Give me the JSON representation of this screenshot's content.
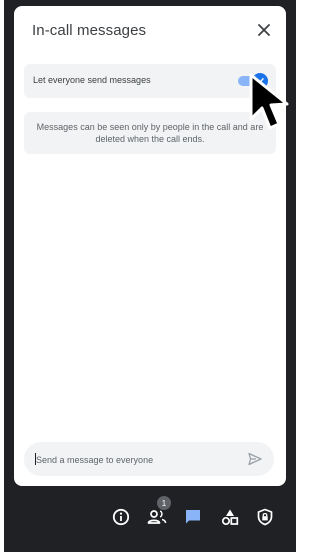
{
  "panel": {
    "title": "In-call messages",
    "close_icon": "close-icon"
  },
  "settings": {
    "toggle_label": "Let everyone send messages",
    "toggle_on": true,
    "accent": "#1a73e8"
  },
  "notice": {
    "text": "Messages can be seen only by people in the call and are deleted when the call ends."
  },
  "composer": {
    "placeholder": "Send a message to everyone",
    "send_icon": "send-icon"
  },
  "toolbar": {
    "items": [
      {
        "icon": "info-icon"
      },
      {
        "icon": "people-icon",
        "badge": "1"
      },
      {
        "icon": "chat-icon",
        "active": true
      },
      {
        "icon": "activities-icon"
      },
      {
        "icon": "host-controls-icon"
      }
    ]
  },
  "colors": {
    "background": "#202124",
    "panel": "#ffffff",
    "surface": "#f1f3f4",
    "text": "#3c4043",
    "muted": "#5f6368"
  }
}
